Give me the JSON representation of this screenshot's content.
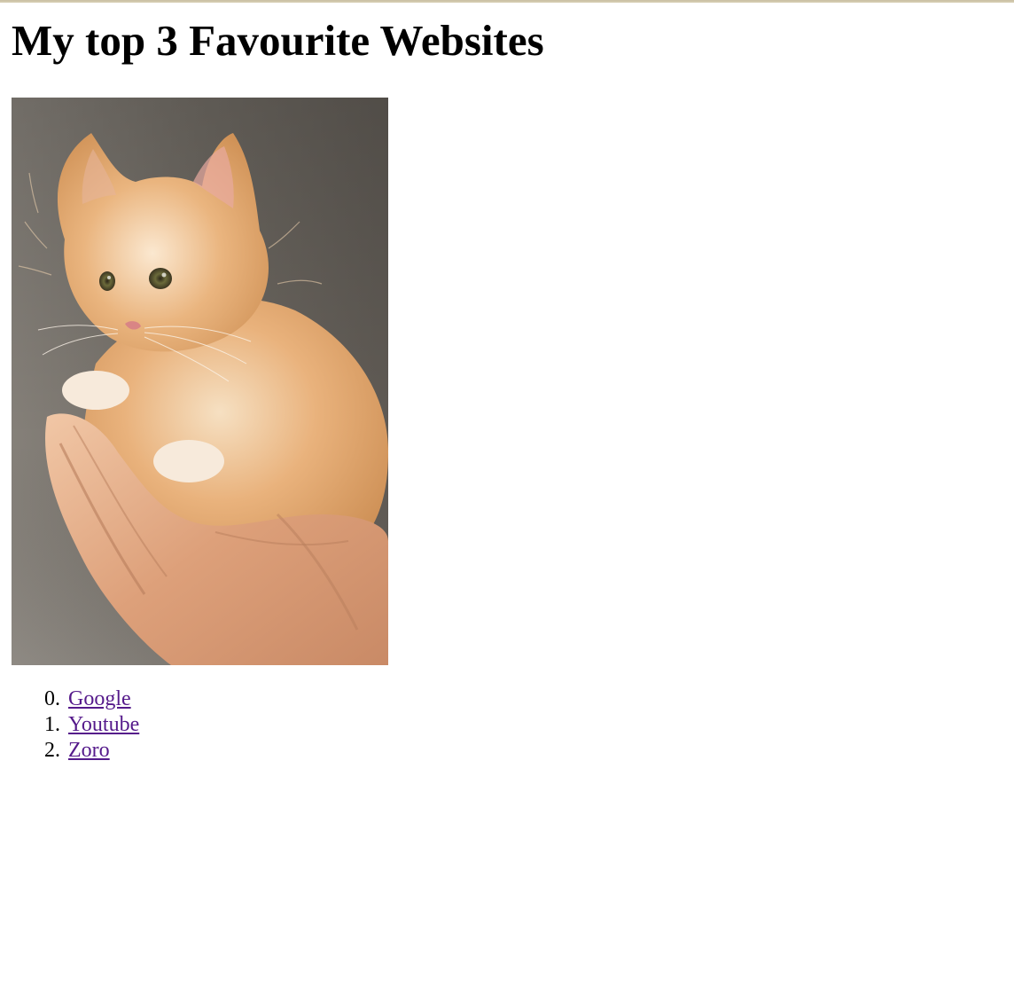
{
  "page": {
    "title": "My top 3 Favourite Websites"
  },
  "image": {
    "subject": "kitten-held-in-hands"
  },
  "links": [
    {
      "number": "0.",
      "label": "Google"
    },
    {
      "number": "1.",
      "label": "Youtube"
    },
    {
      "number": "2.",
      "label": "Zoro"
    }
  ],
  "colors": {
    "link_visited": "#551a8b",
    "text": "#000000",
    "background": "#ffffff"
  }
}
